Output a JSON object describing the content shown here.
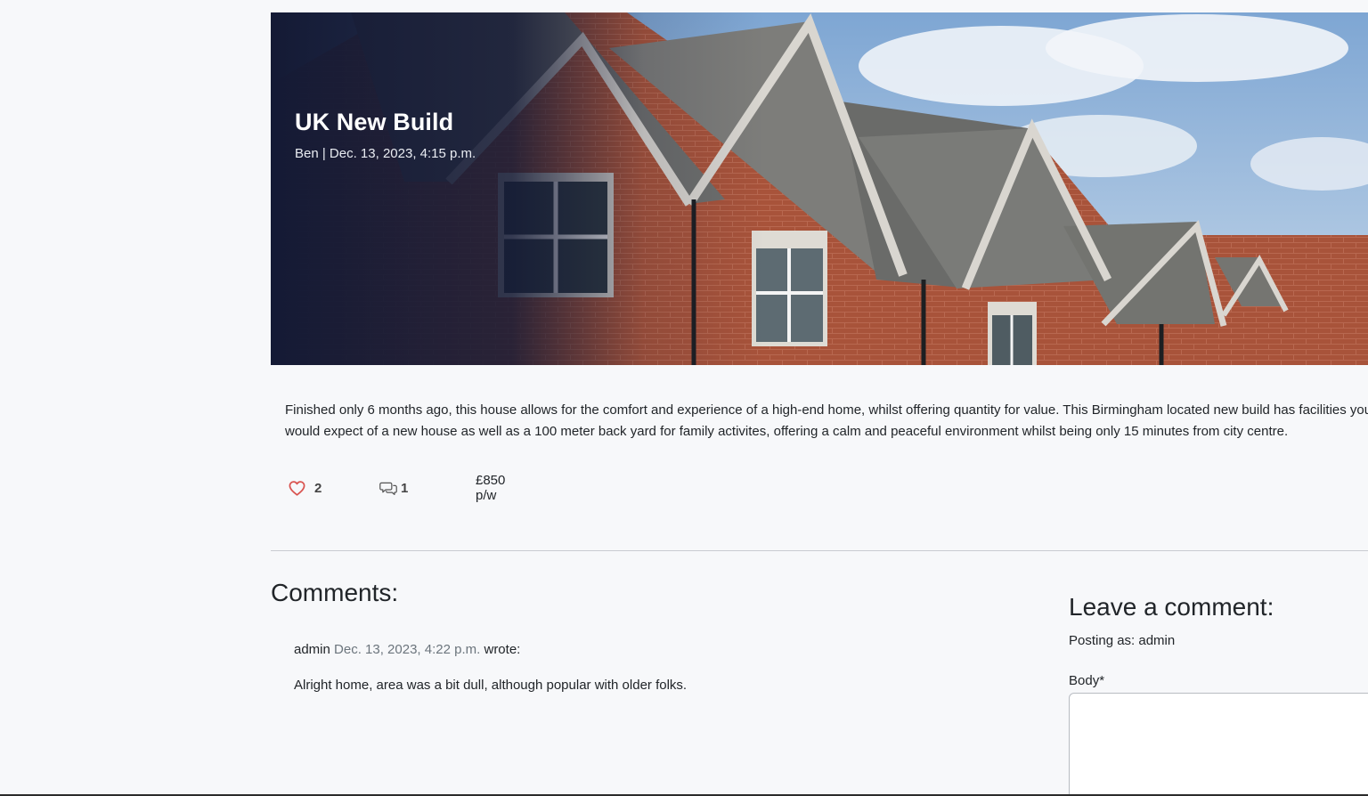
{
  "post": {
    "title": "UK New Build",
    "meta": "Ben | Dec. 13, 2023, 4:15 p.m.",
    "description": "Finished only 6 months ago, this house allows for the comfort and experience of a high-end home, whilst offering quantity for value. This Birmingham located new build has facilities you would expect of  a new house as well as a 100 meter back yard for family activites, offering a calm and peaceful environment whilst being only 15 minutes from city centre.",
    "likes_count": "2",
    "comments_count": "1",
    "price": "£850 p/w",
    "icons": {
      "like": "heart-outline-icon",
      "comments": "chat-bubbles-icon"
    },
    "colors": {
      "like": "#d9534f",
      "overlay": "#141a35"
    }
  },
  "comments": {
    "heading": "Comments:",
    "items": [
      {
        "author": "admin",
        "date": "Dec. 13, 2023, 4:22 p.m.",
        "wrote": "wrote:",
        "body": "Alright home, area was a bit dull, although popular with older folks."
      }
    ]
  },
  "comment_form": {
    "heading": "Leave a comment:",
    "posting_as": "Posting as: admin",
    "body_label": "Body*",
    "body_value": ""
  }
}
